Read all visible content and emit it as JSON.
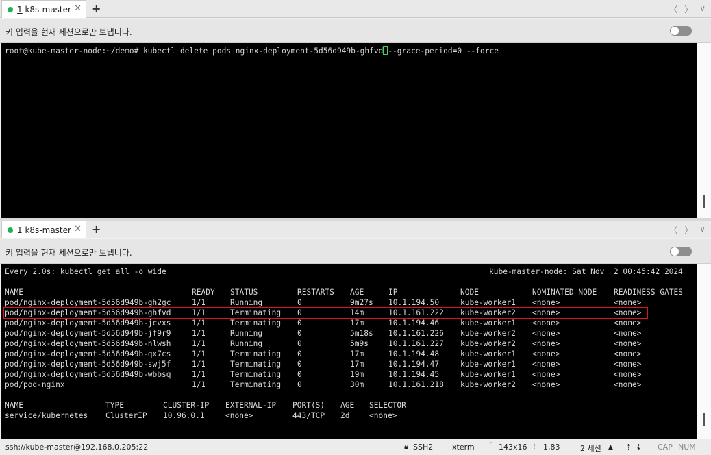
{
  "top_pane": {
    "tab": {
      "index": "1",
      "name": "k8s-master",
      "close": "✕",
      "add": "+"
    },
    "nav": {
      "prev": "〈",
      "next": "〉",
      "menu": "∨"
    },
    "info_message": "키 입력을 현재 세션으로만 보냅니다.",
    "lines": [
      "root@kube-master-node:~/demo# kubectl delete pods nginx-deployment-5d56d949b-ghfvd",
      "--grace-period=0 --force"
    ]
  },
  "bottom_pane": {
    "tab": {
      "index": "1",
      "name": "k8s-master",
      "close": "✕",
      "add": "+"
    },
    "nav": {
      "prev": "〈",
      "next": "〉",
      "menu": "∨"
    },
    "info_message": "키 입력을 현재 세션으로만 보냅니다.",
    "watch_header_left": "Every 2.0s: kubectl get all -o wide",
    "watch_header_right": "kube-master-node: Sat Nov  2 00:45:42 2024",
    "pod_header": [
      "NAME",
      "READY",
      "STATUS",
      "RESTARTS",
      "AGE",
      "IP",
      "NODE",
      "NOMINATED NODE",
      "READINESS GATES"
    ],
    "pods": [
      [
        "pod/nginx-deployment-5d56d949b-gh2gc",
        "1/1",
        "Running",
        "0",
        "9m27s",
        "10.1.194.50",
        "kube-worker1",
        "<none>",
        "<none>"
      ],
      [
        "pod/nginx-deployment-5d56d949b-ghfvd",
        "1/1",
        "Terminating",
        "0",
        "14m",
        "10.1.161.222",
        "kube-worker2",
        "<none>",
        "<none>"
      ],
      [
        "pod/nginx-deployment-5d56d949b-jcvxs",
        "1/1",
        "Terminating",
        "0",
        "17m",
        "10.1.194.46",
        "kube-worker1",
        "<none>",
        "<none>"
      ],
      [
        "pod/nginx-deployment-5d56d949b-jf9r9",
        "1/1",
        "Running",
        "0",
        "5m18s",
        "10.1.161.226",
        "kube-worker2",
        "<none>",
        "<none>"
      ],
      [
        "pod/nginx-deployment-5d56d949b-nlwsh",
        "1/1",
        "Running",
        "0",
        "5m9s",
        "10.1.161.227",
        "kube-worker2",
        "<none>",
        "<none>"
      ],
      [
        "pod/nginx-deployment-5d56d949b-qx7cs",
        "1/1",
        "Terminating",
        "0",
        "17m",
        "10.1.194.48",
        "kube-worker1",
        "<none>",
        "<none>"
      ],
      [
        "pod/nginx-deployment-5d56d949b-swj5f",
        "1/1",
        "Terminating",
        "0",
        "17m",
        "10.1.194.47",
        "kube-worker1",
        "<none>",
        "<none>"
      ],
      [
        "pod/nginx-deployment-5d56d949b-wbbsq",
        "1/1",
        "Terminating",
        "0",
        "19m",
        "10.1.194.45",
        "kube-worker1",
        "<none>",
        "<none>"
      ],
      [
        "pod/pod-nginx",
        "1/1",
        "Terminating",
        "0",
        "30m",
        "10.1.161.218",
        "kube-worker2",
        "<none>",
        "<none>"
      ]
    ],
    "svc_header": [
      "NAME",
      "TYPE",
      "CLUSTER-IP",
      "EXTERNAL-IP",
      "PORT(S)",
      "AGE",
      "SELECTOR"
    ],
    "services": [
      [
        "service/kubernetes",
        "ClusterIP",
        "10.96.0.1",
        "<none>",
        "443/TCP",
        "2d",
        "<none>"
      ]
    ]
  },
  "status_bar": {
    "connection": "ssh://kube-master@192.168.0.205:22",
    "protocol": "SSH2",
    "term_type": "xterm",
    "size": "143x16",
    "cursor_pos": "1,83",
    "sessions": "2 세션",
    "caps": "CAP",
    "num": "NUM"
  },
  "colors": {
    "terminal_bg": "#000000",
    "terminal_fg": "#d7d7d7",
    "highlight_border": "#e0121b",
    "session_dot": "#1fb14a",
    "cursor": "#3bd65a"
  }
}
